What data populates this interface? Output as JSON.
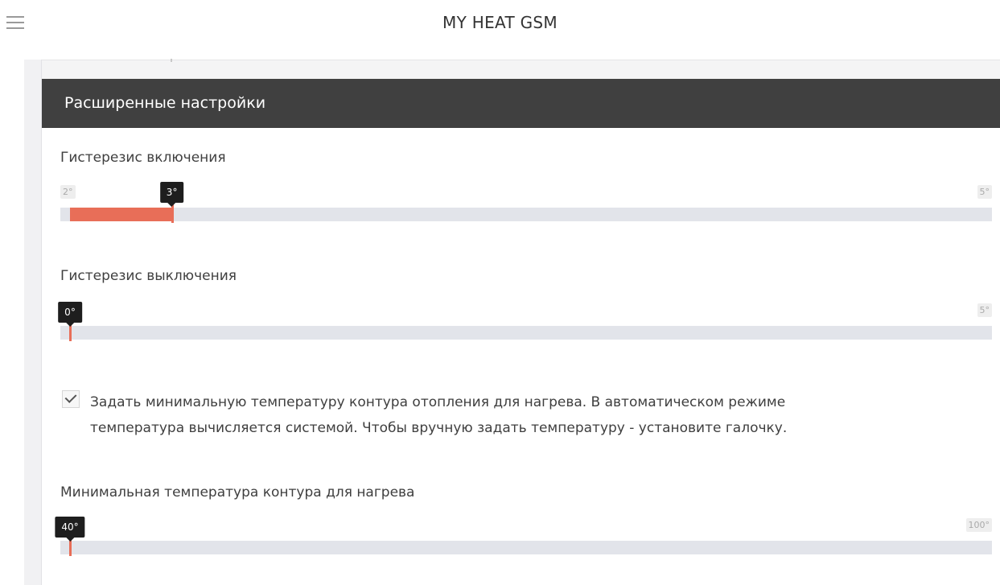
{
  "app": {
    "title": "MY HEAT GSM"
  },
  "icons": {
    "menu": "hamburger-menu-icon",
    "check": "checkmark-icon"
  },
  "colors": {
    "accent": "#e86e58",
    "header_bg": "#404040",
    "tooltip_bg": "#1e1e1e",
    "track": "#e2e4ea"
  },
  "section": {
    "title": "Расширенные настройки"
  },
  "sliders": [
    {
      "label": "Гистерезис включения",
      "min": "2°",
      "max": "5°",
      "value": "3°",
      "min_value": 2,
      "max_value": 5,
      "current": 3
    },
    {
      "label": "Гистерезис выключения",
      "min": "",
      "max": "5°",
      "value": "0°",
      "min_value": 0,
      "max_value": 5,
      "current": 0
    },
    {
      "label": "Минимальная температура контура для нагрева",
      "min": "",
      "max": "100°",
      "value": "40°",
      "min_value": 40,
      "max_value": 100,
      "current": 40
    }
  ],
  "checkbox": {
    "checked": true,
    "text_line1": "Задать минимальную температуру контура отопления для нагрева. В автоматическом режиме",
    "text_line2": "температура вычисляется системой. Чтобы вручную задать температуру - установите галочку."
  }
}
